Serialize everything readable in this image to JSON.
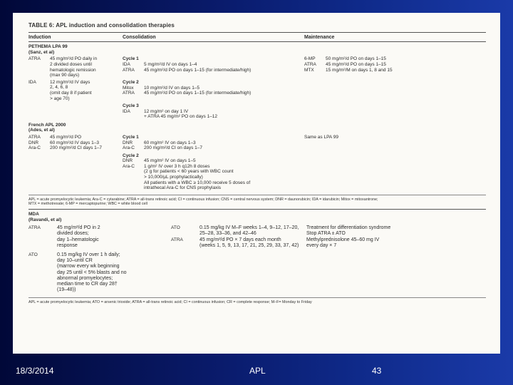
{
  "table": {
    "title": "TABLE 6: APL induction and consolidation therapies",
    "headers": {
      "induction": "Induction",
      "consolidation": "Consolidation",
      "maintenance": "Maintenance"
    },
    "pethema": {
      "title": "PETHEMA LPA 99",
      "subtitle": "(Sanz, et al)",
      "induction": [
        {
          "agent": "ATRA",
          "text": "45 mg/m²/d PO daily in\n2 divided doses until\nhematologic remission\n(max 90 days)"
        },
        {
          "agent": "IDA",
          "text": "12 mg/m²/d IV days\n2, 4, 6, 8\n(omit day 8 if patient\n> age 70)"
        }
      ],
      "cycles": [
        {
          "label": "Cycle 1",
          "items": [
            {
              "agent": "IDA",
              "text": "5 mg/m²/d IV on days 1–4"
            },
            {
              "agent": "ATRA",
              "text": "45 mg/m²/d PO on days 1–15 (for intermediate/high)"
            }
          ]
        },
        {
          "label": "Cycle 2",
          "items": [
            {
              "agent": "Mitox",
              "text": "10 mg/m²/d IV on days 1–5"
            },
            {
              "agent": "ATRA",
              "text": "45 mg/m²/d PO on days 1–15 (for intermediate/high)"
            }
          ]
        },
        {
          "label": "Cycle 3",
          "items": [
            {
              "agent": "IDA",
              "text": "12 mg/m² on day 1 IV\n+ ATRA 45 mg/m² PO on days 1–12"
            }
          ]
        }
      ],
      "maintenance": [
        {
          "agent": "6-MP",
          "text": "50 mg/m²/d PO on days 1–15"
        },
        {
          "agent": "ATRA",
          "text": "45 mg/m²/d PO on days 1–15"
        },
        {
          "agent": "MTX",
          "text": "15 mg/m²/M on days 1, 8 and 15"
        }
      ]
    },
    "french": {
      "title": "French APL 2000",
      "subtitle": "(Ades, et al)",
      "induction": [
        {
          "agent": "ATRA",
          "text": "45 mg/m²/d PO"
        },
        {
          "agent": "DNR",
          "text": "60 mg/m²/d IV days 1–3"
        },
        {
          "agent": "Ara-C",
          "text": "200 mg/m²/d CI days 1–7"
        }
      ],
      "cycles": [
        {
          "label": "Cycle 1",
          "items": [
            {
              "agent": "DNR",
              "text": "60 mg/m² IV on days 1–3"
            },
            {
              "agent": "Ara-C",
              "text": "200 mg/m²/d CI on days 1–7"
            }
          ]
        },
        {
          "label": "Cycle 2",
          "items": [
            {
              "agent": "DNR",
              "text": "45 mg/m² IV on days 1–5"
            },
            {
              "agent": "Ara-C",
              "text": "1 g/m² IV over 3 h q12h 8 doses\n(2 g for patients < 60 years with WBC count\n> 10,000/µL prophylactically)\nAll patients with a WBC ≥ 10,000 receive 5 doses of\nintrathecal Ara-C for CNS prophylaxis"
            }
          ]
        }
      ],
      "maintenance": "Same as LPA 99"
    },
    "footnote1": "APL = acute promyelocytic leukemia; Ara-C = cytarabine; ATRA = all-trans retinoic acid; CI = continuous infusion; CNS = central nervous system; DNR = daunorubicin; IDA = idarubicin; Mitox = mitoxantrone;\nMTX = methotrexate; 6-MP = mercaptopurine; WBC = white blood cell",
    "mda": {
      "title": "MDA",
      "subtitle": "(Ravandi, et al)",
      "induction": [
        {
          "agent": "ATRA",
          "text": "45 mg/m²/d PO in 2\ndivided doses;\nday 1–hematologic\nresponse"
        },
        {
          "agent": "ATO",
          "text": "0.15 mg/kg IV over 1 h daily;\nday 10–until CR\n(marrow every wk beginning\nday 25 until < 5% blasts and no\nabnormal promyelocytes;\nmedian time to CR day 28†\n(19–48))"
        }
      ],
      "consolidation": [
        {
          "agent": "ATO",
          "text": "0.15 mg/kg IV M–F weeks 1–4, 9–12, 17–20,\n25–28, 33–36, and 42–46"
        },
        {
          "agent": "ATRA",
          "text": "45 mg/m²/d PO × 7 days each month\n(weeks 1, 5, 9, 13, 17, 21, 25, 29, 33, 37, 42)"
        }
      ],
      "notes": "Treatment for differentiation syndrome\nStop ATRA ± ATO\nMethylprednisolone 45–60 mg IV\nevery day × 7"
    },
    "footnote2": "APL = acute promyelocytic leukemia; ATO = arsenic trioxide; ATRA = all-trans retinoic acid; CI = continuous infusion; CR = complete response; M–F= Monday to Friday"
  },
  "footer": {
    "date": "18/3/2014",
    "center": "APL",
    "page": "43"
  }
}
